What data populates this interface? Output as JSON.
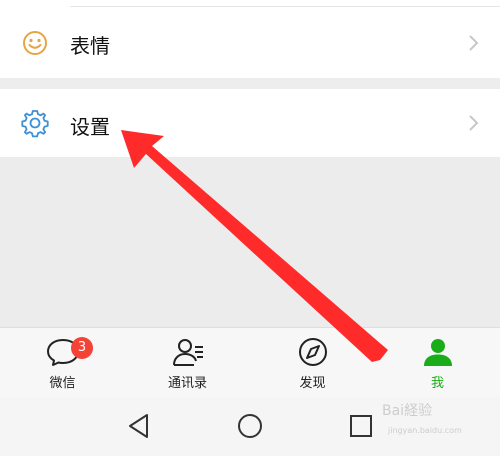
{
  "menu": {
    "sticker": {
      "label": "表情",
      "icon": "smile-icon"
    },
    "settings": {
      "label": "设置",
      "icon": "gear-icon"
    }
  },
  "tabs": [
    {
      "label": "微信",
      "icon": "chat-bubble-icon",
      "badge": "3",
      "active": false
    },
    {
      "label": "通讯录",
      "icon": "contacts-icon",
      "active": false
    },
    {
      "label": "发现",
      "icon": "compass-icon",
      "active": false
    },
    {
      "label": "我",
      "icon": "person-icon",
      "active": true
    }
  ],
  "nav": [
    "back-triangle-icon",
    "home-circle-icon",
    "recent-square-icon"
  ],
  "colors": {
    "accent": "#1aad19",
    "badge": "#f44336",
    "annotation_arrow": "#ff2a2a",
    "icon_orange": "#e7a443",
    "icon_blue": "#3d8fd6"
  },
  "watermark": {
    "main": "Bai経验",
    "sub": "jingyan.baidu.com"
  }
}
